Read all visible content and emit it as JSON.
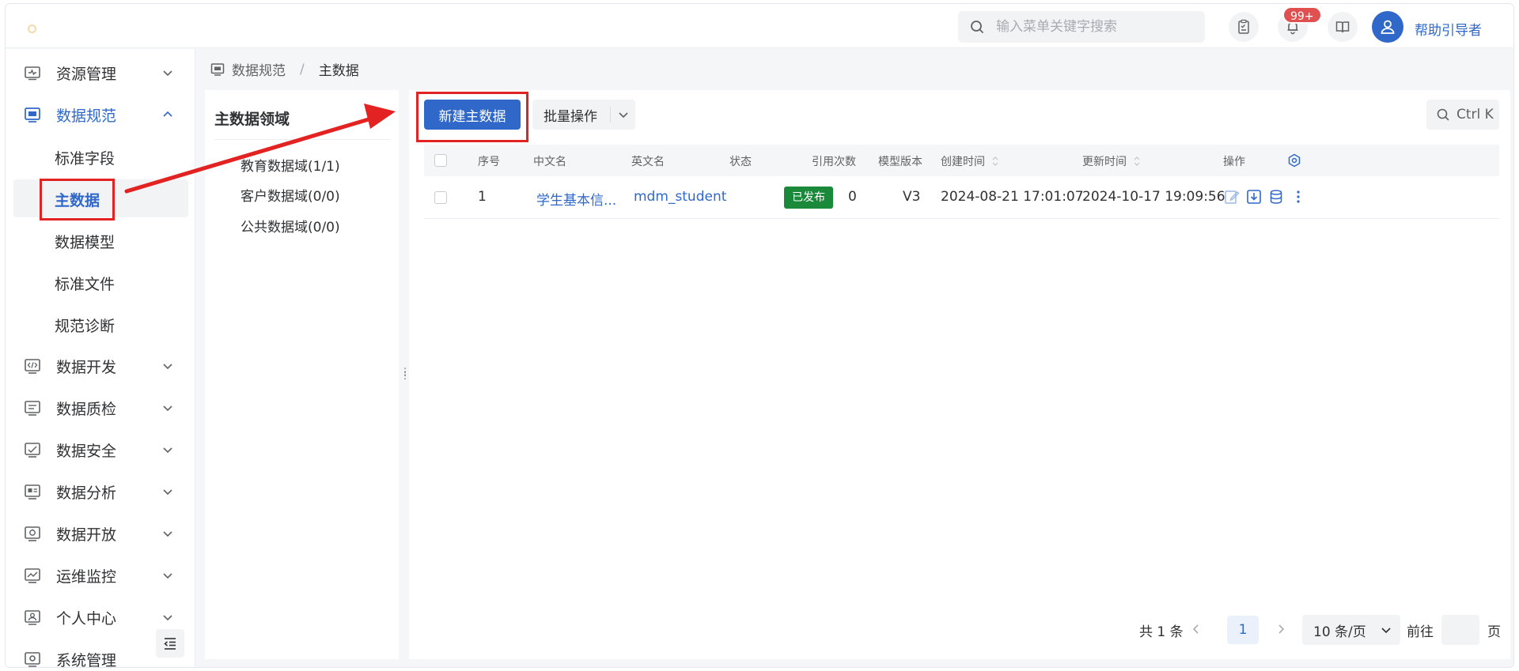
{
  "header": {
    "search_placeholder": "输入菜单关键字搜索",
    "notification_badge": "99+",
    "username": "帮助引导者"
  },
  "sidebar": {
    "items": [
      {
        "label": "资源管理",
        "icon": "resource-icon",
        "expanded": false
      },
      {
        "label": "数据规范",
        "icon": "standard-icon",
        "expanded": true
      },
      {
        "label": "数据开发",
        "icon": "code-icon",
        "expanded": false
      },
      {
        "label": "数据质检",
        "icon": "quality-icon",
        "expanded": false
      },
      {
        "label": "数据安全",
        "icon": "security-icon",
        "expanded": false
      },
      {
        "label": "数据分析",
        "icon": "analysis-icon",
        "expanded": false
      },
      {
        "label": "数据开放",
        "icon": "open-icon",
        "expanded": false
      },
      {
        "label": "运维监控",
        "icon": "monitor-icon",
        "expanded": false
      },
      {
        "label": "个人中心",
        "icon": "user-center-icon",
        "expanded": false
      },
      {
        "label": "系统管理",
        "icon": "system-icon",
        "expanded": false
      }
    ],
    "sub_items": [
      {
        "label": "标准字段",
        "selected": false
      },
      {
        "label": "主数据",
        "selected": true
      },
      {
        "label": "数据模型",
        "selected": false
      },
      {
        "label": "标准文件",
        "selected": false
      },
      {
        "label": "规范诊断",
        "selected": false
      }
    ]
  },
  "breadcrumb": {
    "parent": "数据规范",
    "separator": "/",
    "current": "主数据"
  },
  "domain_panel": {
    "title": "主数据领域",
    "items": [
      "教育数据域(1/1)",
      "客户数据域(0/0)",
      "公共数据域(0/0)"
    ]
  },
  "toolbar": {
    "new_label": "新建主数据",
    "batch_label": "批量操作",
    "shortcut_label": "Ctrl K"
  },
  "table": {
    "columns": [
      "序号",
      "中文名",
      "英文名",
      "状态",
      "引用次数",
      "模型版本",
      "创建时间",
      "更新时间",
      "操作"
    ],
    "rows": [
      {
        "index": "1",
        "cn_name": "学生基本信...",
        "en_name": "mdm_student",
        "status": "已发布",
        "ref_count": "0",
        "version": "V3",
        "created": "2024-08-21 17:01:07",
        "updated": "2024-10-17 19:09:56"
      }
    ]
  },
  "pagination": {
    "total": "共 1 条",
    "current_page": "1",
    "page_size": "10 条/页",
    "goto_label": "前往",
    "page_label": "页"
  },
  "colors": {
    "accent": "#2f68c9",
    "status_published": "#1a8a3a",
    "annotation": "#e32222"
  }
}
